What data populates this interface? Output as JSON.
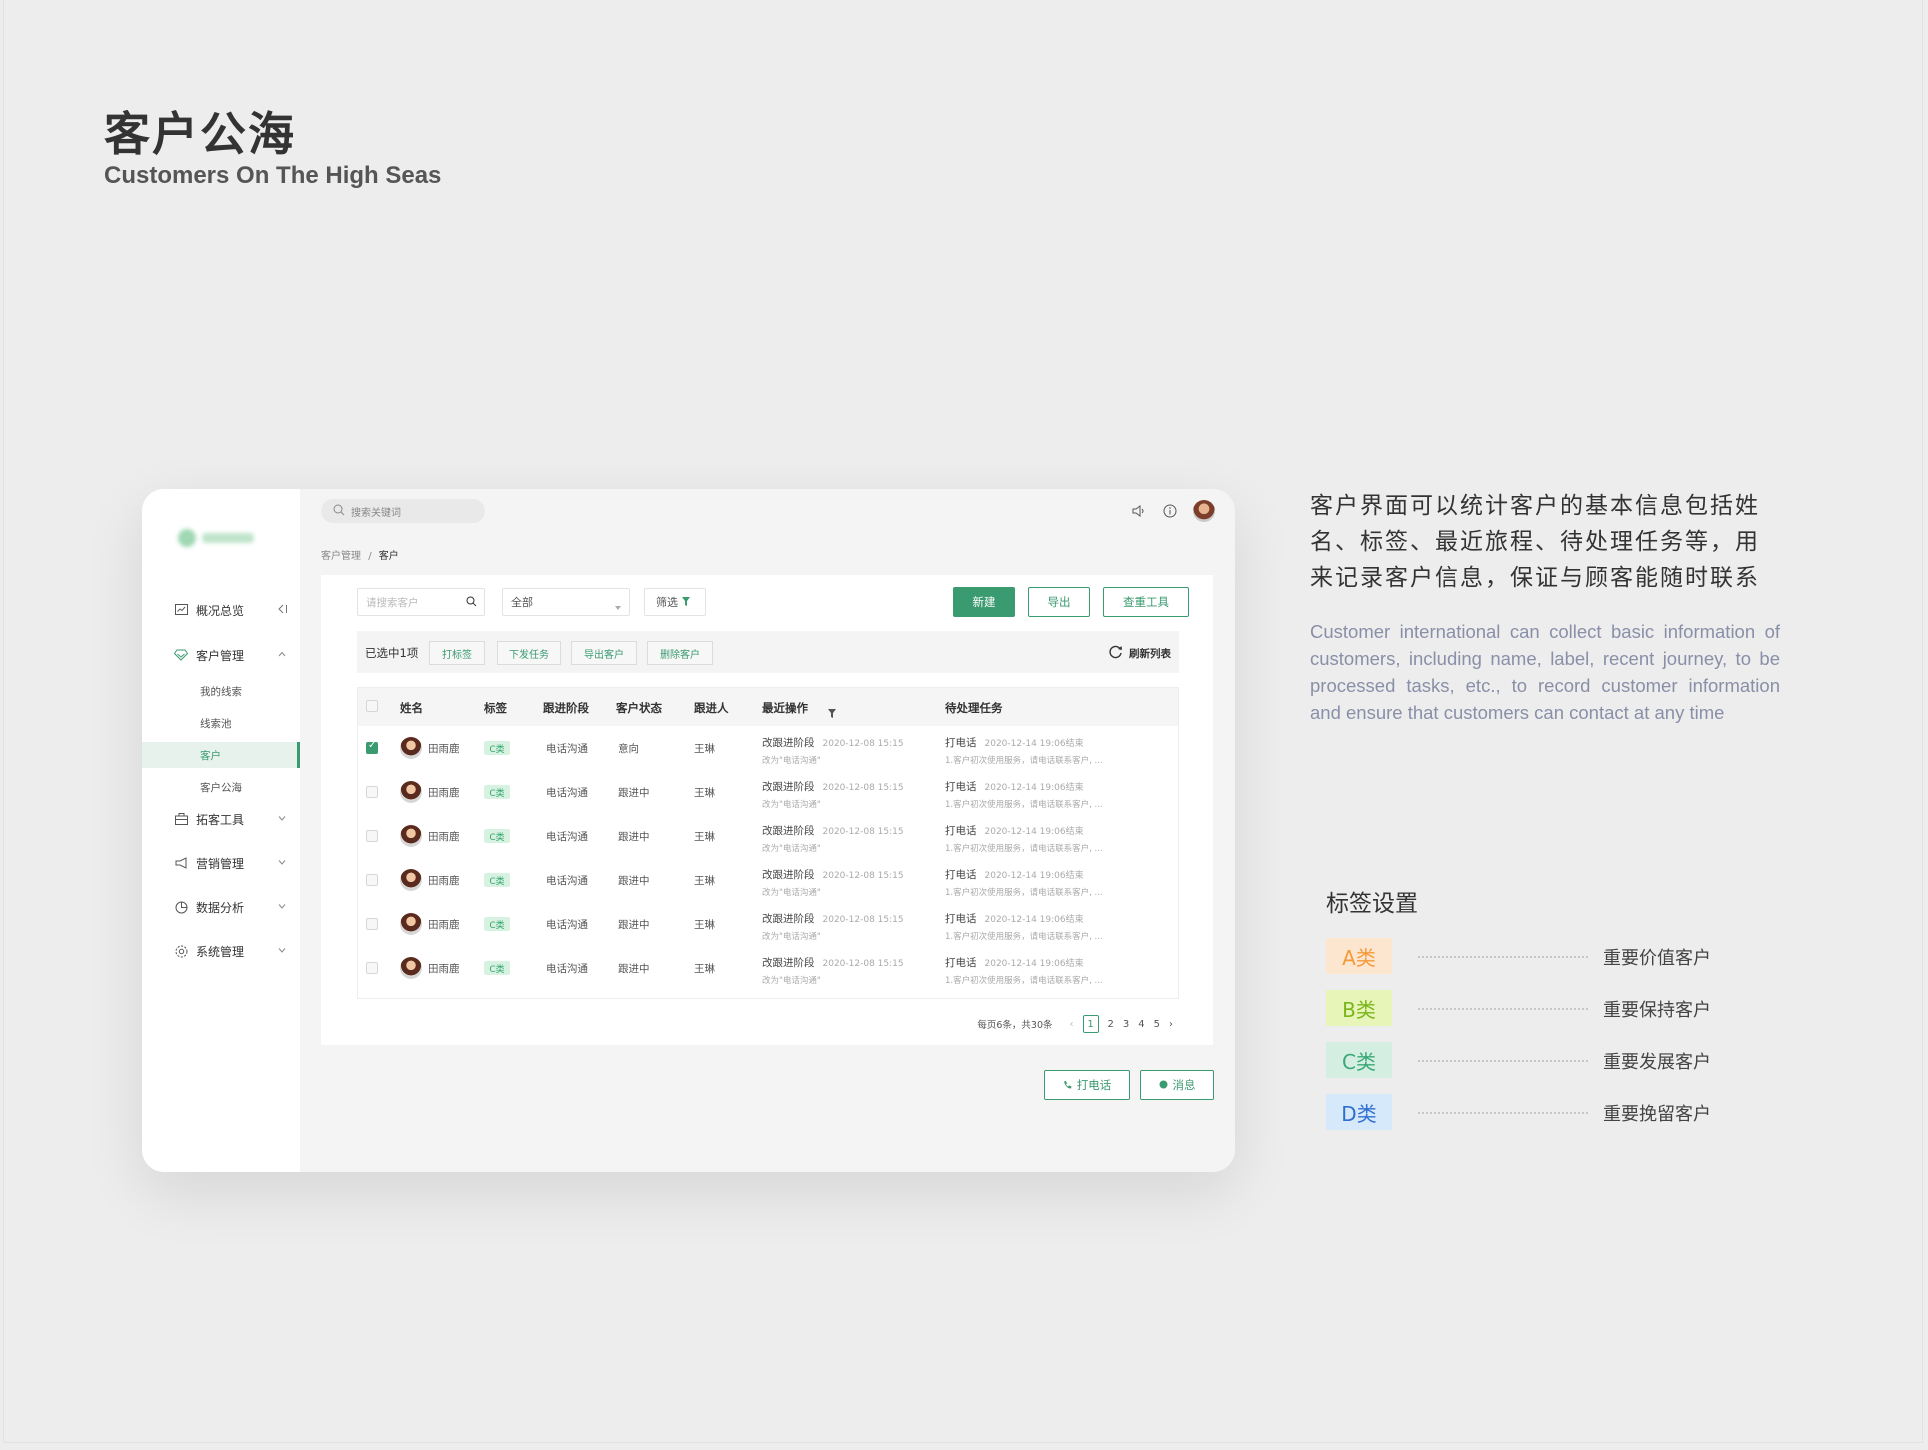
{
  "hero": {
    "title": "客户公海",
    "subtitle": "Customers On The High Seas"
  },
  "app": {
    "search_placeholder": "搜索关键词",
    "breadcrumb": {
      "parent": "客户管理",
      "sep": "/",
      "current": "客户"
    },
    "sidebar": {
      "items": [
        {
          "label": "概况总览",
          "icon": "dashboard-icon"
        },
        {
          "label": "客户管理",
          "icon": "diamond-icon",
          "chevron": "^"
        },
        {
          "label": "我的线索"
        },
        {
          "label": "线索池"
        },
        {
          "label": "客户"
        },
        {
          "label": "客户公海"
        },
        {
          "label": "拓客工具",
          "icon": "briefcase-icon",
          "chevron": "v"
        },
        {
          "label": "营销管理",
          "icon": "megaphone-icon",
          "chevron": "v"
        },
        {
          "label": "数据分析",
          "icon": "pie-chart-icon",
          "chevron": "v"
        },
        {
          "label": "系统管理",
          "icon": "gear-icon",
          "chevron": "v"
        }
      ]
    },
    "toolbar": {
      "search_placeholder": "请搜索客户",
      "select_value": "全部",
      "filter_label": "筛选",
      "new_label": "新建",
      "export_label": "导出",
      "dedupe_label": "查重工具"
    },
    "bulk": {
      "selected_text": "已选中1项",
      "tag_label": "打标签",
      "task_label": "下发任务",
      "export_label": "导出客户",
      "delete_label": "删除客户",
      "refresh_label": "刷新列表"
    },
    "table": {
      "headers": [
        "姓名",
        "标签",
        "跟进阶段",
        "客户状态",
        "跟进人",
        "最近操作",
        "待处理任务"
      ],
      "rows": [
        {
          "name": "田雨鹿",
          "tag": "C类",
          "stage": "电话沟通",
          "status": "意向",
          "owner": "王琳",
          "op_title": "改跟进阶段",
          "op_time": "2020-12-08 15:15",
          "op_detail": "改为\"电话沟通\"",
          "task_title": "打电话",
          "task_time": "2020-12-14 19:06结束",
          "task_detail": "1.客户初次使用服务，请电话联系客户, ..."
        },
        {
          "name": "田雨鹿",
          "tag": "C类",
          "stage": "电话沟通",
          "status": "跟进中",
          "owner": "王琳",
          "op_title": "改跟进阶段",
          "op_time": "2020-12-08 15:15",
          "op_detail": "改为\"电话沟通\"",
          "task_title": "打电话",
          "task_time": "2020-12-14 19:06结束",
          "task_detail": "1.客户初次使用服务，请电话联系客户, ..."
        },
        {
          "name": "田雨鹿",
          "tag": "C类",
          "stage": "电话沟通",
          "status": "跟进中",
          "owner": "王琳",
          "op_title": "改跟进阶段",
          "op_time": "2020-12-08 15:15",
          "op_detail": "改为\"电话沟通\"",
          "task_title": "打电话",
          "task_time": "2020-12-14 19:06结束",
          "task_detail": "1.客户初次使用服务，请电话联系客户, ..."
        },
        {
          "name": "田雨鹿",
          "tag": "C类",
          "stage": "电话沟通",
          "status": "跟进中",
          "owner": "王琳",
          "op_title": "改跟进阶段",
          "op_time": "2020-12-08 15:15",
          "op_detail": "改为\"电话沟通\"",
          "task_title": "打电话",
          "task_time": "2020-12-14 19:06结束",
          "task_detail": "1.客户初次使用服务，请电话联系客户, ..."
        },
        {
          "name": "田雨鹿",
          "tag": "C类",
          "stage": "电话沟通",
          "status": "跟进中",
          "owner": "王琳",
          "op_title": "改跟进阶段",
          "op_time": "2020-12-08 15:15",
          "op_detail": "改为\"电话沟通\"",
          "task_title": "打电话",
          "task_time": "2020-12-14 19:06结束",
          "task_detail": "1.客户初次使用服务，请电话联系客户, ..."
        },
        {
          "name": "田雨鹿",
          "tag": "C类",
          "stage": "电话沟通",
          "status": "跟进中",
          "owner": "王琳",
          "op_title": "改跟进阶段",
          "op_time": "2020-12-08 15:15",
          "op_detail": "改为\"电话沟通\"",
          "task_title": "打电话",
          "task_time": "2020-12-14 19:06结束",
          "task_detail": "1.客户初次使用服务，请电话联系客户, ..."
        }
      ]
    },
    "pagination": {
      "summary": "每页6条，共30条",
      "pages": [
        "1",
        "2",
        "3",
        "4",
        "5"
      ],
      "current": "1"
    },
    "actions": {
      "call_label": "打电话",
      "message_label": "消息"
    }
  },
  "description": {
    "cn": "客户界面可以统计客户的基本信息包括姓名、标签、最近旅程、待处理任务等，用来记录客户信息，保证与顾客能随时联系",
    "en": "Customer international can collect basic information of customers, including name, label, recent journey, to be processed tasks, etc., to record customer information and ensure that customers can contact at any time"
  },
  "legend": {
    "title": "标签设置",
    "items": [
      {
        "chip": "A类",
        "desc": "重要价值客户",
        "bg": "#fde6cf",
        "fg": "#f39a3c"
      },
      {
        "chip": "B类",
        "desc": "重要保持客户",
        "bg": "#e7f6b8",
        "fg": "#7ab51d"
      },
      {
        "chip": "C类",
        "desc": "重要发展客户",
        "bg": "#d4efe2",
        "fg": "#3aa876"
      },
      {
        "chip": "D类",
        "desc": "重要挽留客户",
        "bg": "#d6e9fb",
        "fg": "#2f6fd1"
      }
    ]
  },
  "colors": {
    "accent": "#3a9a70",
    "background": "#ededed"
  }
}
